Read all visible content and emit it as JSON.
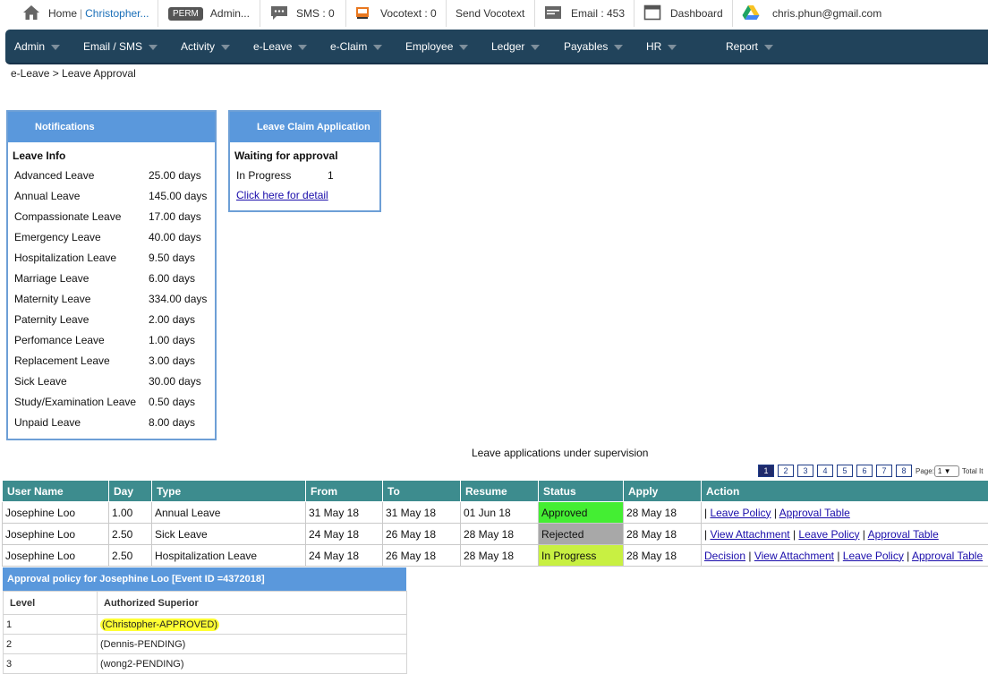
{
  "topbar": {
    "home_label": "Home",
    "user_name": "Christopher...",
    "perm_badge": "PERM",
    "admin_label": "Admin...",
    "sms_label": "SMS : 0",
    "vocotext_label": "Vocotext : 0",
    "send_vocotext_label": "Send Vocotext",
    "email_label": "Email : 453",
    "dashboard_label": "Dashboard",
    "account_email": "chris.phun@gmail.com"
  },
  "nav": {
    "items": [
      "Admin",
      "Email / SMS",
      "Activity",
      "e-Leave",
      "e-Claim",
      "Employee",
      "Ledger",
      "Payables",
      "HR",
      "Report"
    ]
  },
  "breadcrumb": "e-Leave > Leave Approval",
  "notifications": {
    "title": "Notifications",
    "section": "Leave Info",
    "rows": [
      {
        "type": "Advanced Leave",
        "days": "25.00 days"
      },
      {
        "type": "Annual Leave",
        "days": "145.00 days"
      },
      {
        "type": "Compassionate Leave",
        "days": "17.00 days"
      },
      {
        "type": "Emergency Leave",
        "days": "40.00 days"
      },
      {
        "type": "Hospitalization Leave",
        "days": "9.50 days"
      },
      {
        "type": "Marriage Leave",
        "days": "6.00 days"
      },
      {
        "type": "Maternity Leave",
        "days": "334.00 days"
      },
      {
        "type": "Paternity Leave",
        "days": "2.00 days"
      },
      {
        "type": "Perfomance Leave",
        "days": "1.00 days"
      },
      {
        "type": "Replacement Leave",
        "days": "3.00 days"
      },
      {
        "type": "Sick Leave",
        "days": "30.00 days"
      },
      {
        "type": "Study/Examination Leave",
        "days": "0.50 days"
      },
      {
        "type": "Unpaid Leave",
        "days": "8.00 days"
      }
    ]
  },
  "claim_panel": {
    "title": "Leave Claim Application",
    "subtitle": "Waiting for approval",
    "status_label": "In Progress",
    "status_count": "1",
    "detail_link": "Click here for detail"
  },
  "applications": {
    "heading": "Leave applications under supervision",
    "pages": [
      "1",
      "2",
      "3",
      "4",
      "5",
      "6",
      "7",
      "8"
    ],
    "page_label": "Page:",
    "page_value": "1",
    "total_label": "Total It",
    "columns": [
      "User Name",
      "Day",
      "Type",
      "From",
      "To",
      "Resume",
      "Status",
      "Apply",
      "Action"
    ],
    "rows": [
      {
        "user": "Josephine Loo",
        "day": "1.00",
        "type": "Annual Leave",
        "from": "31 May 18",
        "to": "31 May 18",
        "resume": "01 Jun 18",
        "status": "Approved",
        "apply": "28 May 18",
        "actions": [
          "Leave Policy",
          "Approval Table"
        ]
      },
      {
        "user": "Josephine Loo",
        "day": "2.50",
        "type": "Sick Leave",
        "from": "24 May 18",
        "to": "26 May 18",
        "resume": "28 May 18",
        "status": "Rejected",
        "apply": "28 May 18",
        "actions": [
          "View Attachment",
          "Leave Policy",
          "Approval Table"
        ]
      },
      {
        "user": "Josephine Loo",
        "day": "2.50",
        "type": "Hospitalization Leave",
        "from": "24 May 18",
        "to": "26 May 18",
        "resume": "28 May 18",
        "status": "In Progress",
        "apply": "28 May 18",
        "actions": [
          "Decision",
          "View Attachment",
          "Leave Policy",
          "Approval Table"
        ]
      }
    ]
  },
  "policy": {
    "title": "Approval policy for Josephine Loo [Event ID =4372018]",
    "col_level": "Level",
    "col_superior": "Authorized Superior",
    "rows": [
      {
        "level": "1",
        "superior": "(Christopher-APPROVED)"
      },
      {
        "level": "2",
        "superior": "(Dennis-PENDING)"
      },
      {
        "level": "3",
        "superior": "(wong2-PENDING)"
      }
    ]
  },
  "colors": {
    "nav_bg": "#21435b",
    "panel_head": "#5a98dc",
    "table_head": "#3d8c8e",
    "approved": "#44ee33",
    "rejected": "#a8a8a8",
    "in_progress": "#c8f042",
    "highlight": "#ffff33"
  }
}
